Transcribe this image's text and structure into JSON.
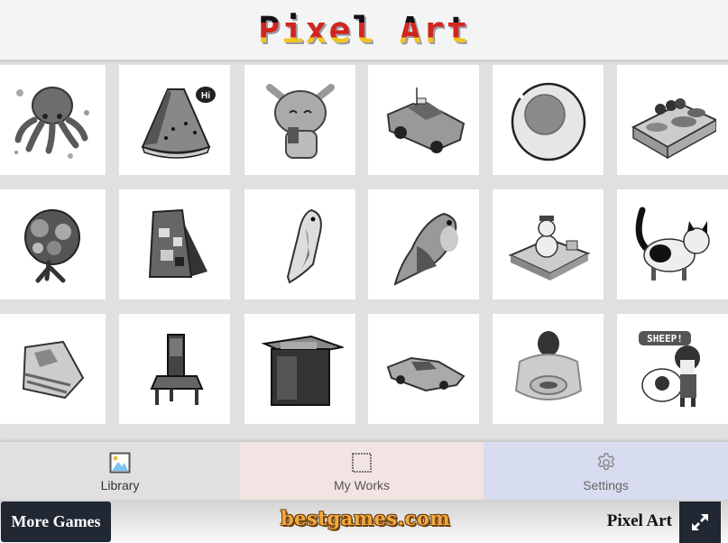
{
  "header": {
    "title": "Pixel Art"
  },
  "gallery": {
    "tiles": [
      {
        "name": "octopus"
      },
      {
        "name": "watermelon-hi"
      },
      {
        "name": "bunny-drink"
      },
      {
        "name": "taxi-car"
      },
      {
        "name": "fried-egg"
      },
      {
        "name": "sushi-platter"
      },
      {
        "name": "tree"
      },
      {
        "name": "sign-board"
      },
      {
        "name": "bird-small"
      },
      {
        "name": "bird-sparrow"
      },
      {
        "name": "snowman-gift"
      },
      {
        "name": "cat"
      },
      {
        "name": "cake-slice"
      },
      {
        "name": "throne-chair"
      },
      {
        "name": "crate-table"
      },
      {
        "name": "sports-car"
      },
      {
        "name": "roll-cake"
      },
      {
        "name": "girl-sheep"
      }
    ],
    "bubble_text_hi": "Hi",
    "bubble_text_sheep": "SHEEP!"
  },
  "nav": {
    "items": [
      {
        "label": "Library",
        "icon": "image-icon"
      },
      {
        "label": "My Works",
        "icon": "square-icon"
      },
      {
        "label": "Settings",
        "icon": "gear-icon"
      }
    ],
    "colors": {
      "library_bg": "#e0e0e0",
      "works_bg": "#f3e4e4",
      "settings_bg": "#d7dcf0"
    }
  },
  "footer": {
    "more_games_label": "More Games",
    "brand": "bestgames.com",
    "title": "Pixel Art",
    "fullscreen_icon": "expand-icon"
  }
}
